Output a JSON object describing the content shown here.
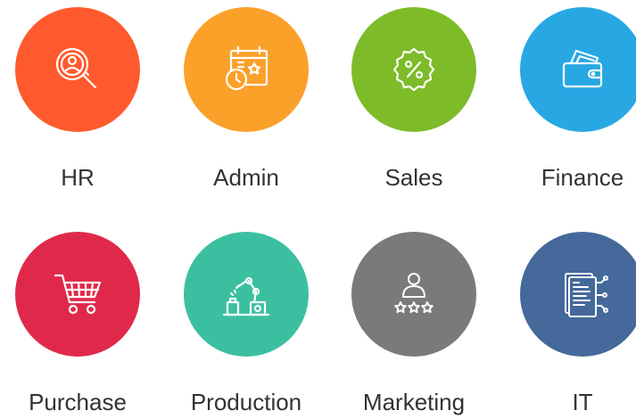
{
  "departments": [
    {
      "label": "HR",
      "color": "#ff5a2d",
      "icon": "search-user-icon"
    },
    {
      "label": "Admin",
      "color": "#fba12a",
      "icon": "calendar-clock-icon"
    },
    {
      "label": "Sales",
      "color": "#7dbb29",
      "icon": "discount-badge-icon"
    },
    {
      "label": "Finance",
      "color": "#27a8e3",
      "icon": "wallet-icon"
    },
    {
      "label": "Purchase",
      "color": "#e0294a",
      "icon": "shopping-cart-icon"
    },
    {
      "label": "Production",
      "color": "#3cbfa0",
      "icon": "robot-arm-icon"
    },
    {
      "label": "Marketing",
      "color": "#7a7a7a",
      "icon": "user-rating-icon"
    },
    {
      "label": "IT",
      "color": "#44699a",
      "icon": "document-network-icon"
    }
  ]
}
